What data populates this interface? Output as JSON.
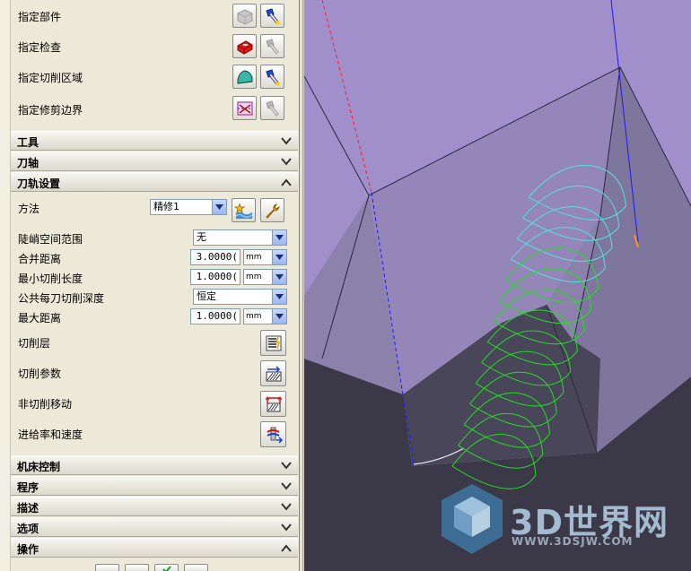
{
  "geometry_section": {
    "items": [
      {
        "label": "指定部件"
      },
      {
        "label": "指定检查"
      },
      {
        "label": "指定切削区域"
      },
      {
        "label": "指定修剪边界"
      }
    ]
  },
  "sections": {
    "tool": "工具",
    "axis": "刀轴",
    "path_settings": "刀轨设置",
    "machine_control": "机床控制",
    "program": "程序",
    "description": "描述",
    "options": "选项",
    "actions": "操作"
  },
  "path_settings": {
    "method_label": "方法",
    "method_value": "精修1",
    "steep_label": "陡峭空间范围",
    "steep_value": "无",
    "merge_label": "合并距离",
    "merge_value": "3.0000(",
    "merge_unit": "mm",
    "min_cut_label": "最小切削长度",
    "min_cut_value": "1.0000(",
    "min_cut_unit": "mm",
    "depth_label": "公共每刀切削深度",
    "depth_value": "恒定",
    "max_dist_label": "最大距离",
    "max_dist_value": "1.0000(",
    "max_dist_unit": "mm",
    "cut_levels": "切削层",
    "cut_params": "切削参数",
    "non_cut_moves": "非切削移动",
    "feeds_speeds": "进给率和速度"
  },
  "watermark": {
    "brand": "3D世界网",
    "url": "WWW.3DSJW.COM"
  },
  "colors": {
    "surface_top": "#a08fcb",
    "surface_face": "#8c81ab",
    "floor": "#3c3a48",
    "toolpath_green": "#22dd22",
    "toolpath_cyan": "#55e0e0",
    "axis_red": "#ff0000",
    "axis_blue": "#0000ff"
  }
}
